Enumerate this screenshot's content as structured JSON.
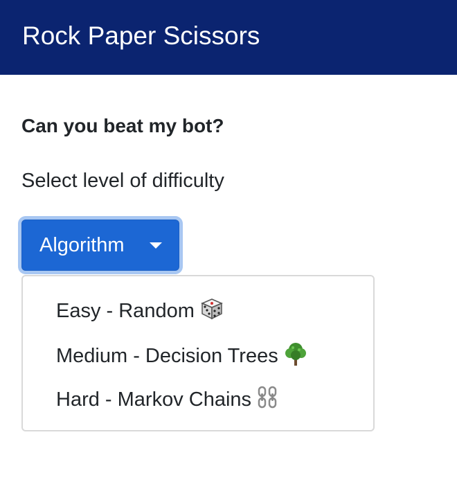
{
  "navbar": {
    "title": "Rock Paper Scissors"
  },
  "main": {
    "heading": "Can you beat my bot?",
    "subtext": "Select level of difficulty"
  },
  "dropdown": {
    "toggle_label": "Algorithm",
    "toggle_color": "#1c67d4",
    "expanded": true,
    "items": [
      {
        "label": "Easy - Random",
        "icon": "dice-icon"
      },
      {
        "label": "Medium - Decision Trees",
        "icon": "tree-icon"
      },
      {
        "label": "Hard - Markov Chains",
        "icon": "chain-icon"
      }
    ]
  },
  "colors": {
    "navbar_bg": "#0b2470",
    "button_bg": "#1c67d4",
    "focus_ring": "#a8c7f2"
  }
}
